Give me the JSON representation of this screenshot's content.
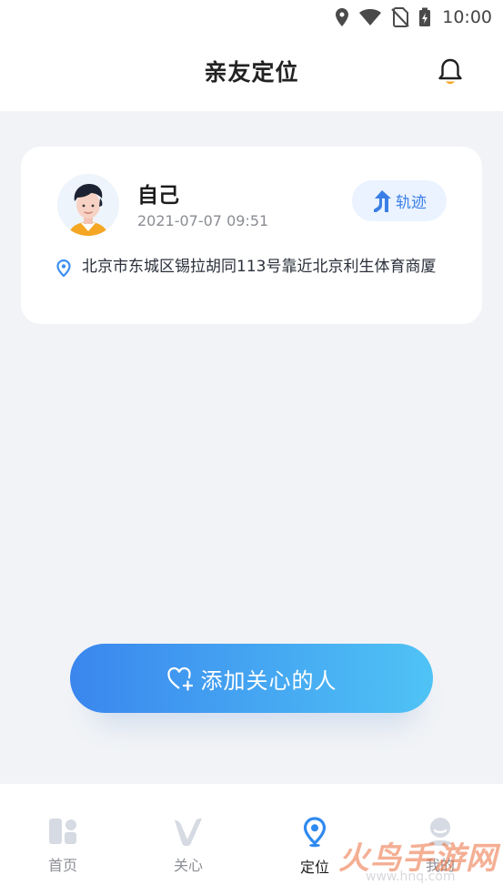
{
  "status_bar": {
    "time": "10:00",
    "icons": [
      "location-pin-icon",
      "wifi-icon",
      "no-sim-icon",
      "battery-charging-icon"
    ]
  },
  "header": {
    "title": "亲友定位",
    "bell_icon": "bell-icon"
  },
  "card": {
    "name": "自己",
    "datetime": "2021-07-07 09:51",
    "track_label": "轨迹",
    "address": "北京市东城区锡拉胡同113号靠近北京利生体育商厦"
  },
  "add_button": {
    "label": "添加关心的人",
    "icon": "heart-plus-icon"
  },
  "bottom_nav": {
    "items": [
      {
        "label": "首页",
        "icon": "home-grid-icon",
        "active": false
      },
      {
        "label": "关心",
        "icon": "care-v-icon",
        "active": false
      },
      {
        "label": "定位",
        "icon": "location-pin-icon",
        "active": true
      },
      {
        "label": "我的",
        "icon": "profile-icon",
        "active": false
      }
    ]
  },
  "watermark": {
    "brand": "火鸟手游网",
    "url": "www.hnq.com"
  },
  "colors": {
    "accent": "#3a86ee",
    "accent_light": "#4fc3f5",
    "background": "#f1f3f6",
    "bell_dot": "#f5a623"
  }
}
